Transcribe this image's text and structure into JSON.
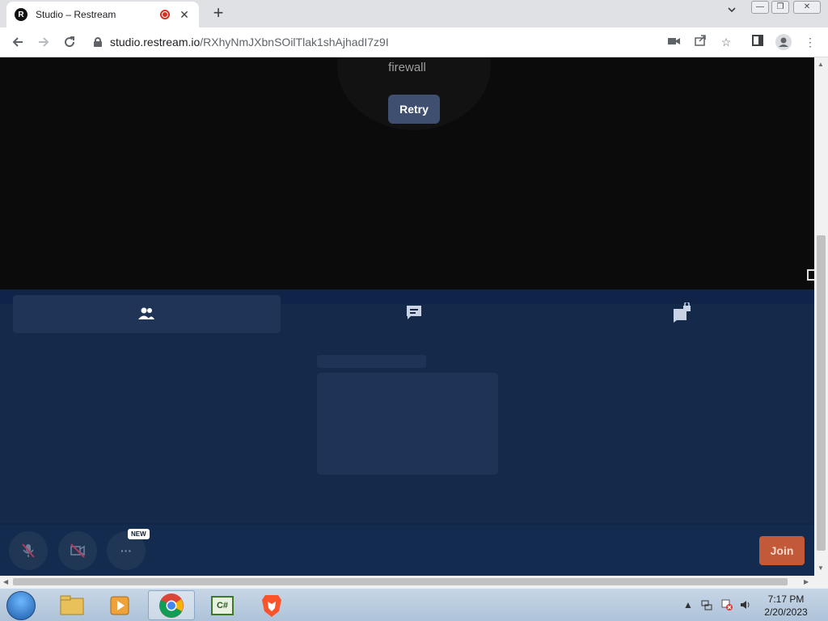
{
  "browser": {
    "tab_title": "Studio – Restream",
    "favicon_letter": "R",
    "close_glyph": "✕",
    "new_tab_glyph": "+",
    "url_host": "studio.restream.io",
    "url_path": "/RXhyNmJXbnSOilTlak1shAjhadI7z9I"
  },
  "stage": {
    "status_text": "firewall",
    "retry_label": "Retry"
  },
  "panel": {
    "tabs": [
      {
        "name": "people",
        "icon": "people-icon"
      },
      {
        "name": "chat",
        "icon": "chat-icon"
      },
      {
        "name": "private-chat",
        "icon": "locked-chat-icon"
      }
    ]
  },
  "controls": {
    "new_badge": "NEW",
    "more_glyph": "···",
    "join_label": "Join"
  },
  "taskbar": {
    "time": "7:17 PM",
    "date": "2/20/2023",
    "csharp_label": "C#"
  },
  "colors": {
    "stage_bg": "#0b0b0b",
    "panel_bg": "#15294a",
    "retry_bg": "#3f4f6f",
    "join_bg": "#c25a3a",
    "recording": "#d93025"
  }
}
